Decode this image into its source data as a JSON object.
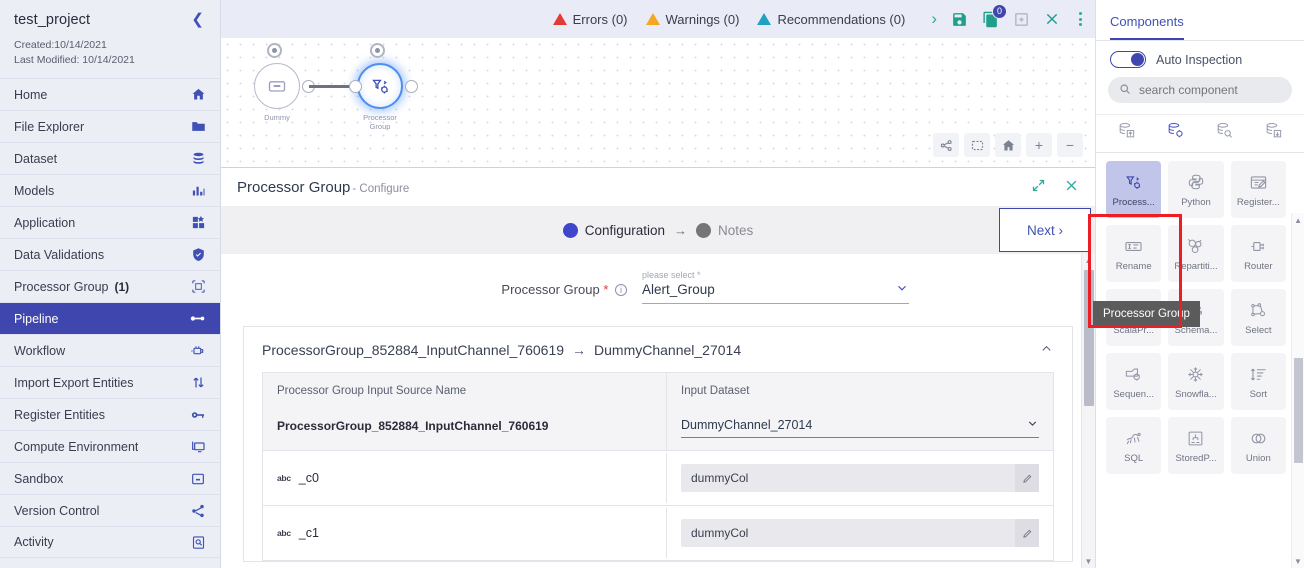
{
  "sidebar": {
    "project_title": "test_project",
    "collapse_icon": "chevron-left-icon",
    "created": "Created:10/14/2021",
    "last_modified": "Last Modified: 10/14/2021",
    "items": [
      {
        "label": "Home",
        "icon": "home-icon",
        "count": "",
        "active": false
      },
      {
        "label": "File Explorer",
        "icon": "folder-icon",
        "count": "",
        "active": false
      },
      {
        "label": "Dataset",
        "icon": "database-icon",
        "count": "",
        "active": false
      },
      {
        "label": "Models",
        "icon": "bar-chart-icon",
        "count": "",
        "active": false
      },
      {
        "label": "Application",
        "icon": "apps-grid-icon",
        "count": "",
        "active": false
      },
      {
        "label": "Data Validations",
        "icon": "shield-check-icon",
        "count": "",
        "active": false
      },
      {
        "label": "Processor Group",
        "icon": "processor-group-icon",
        "count": "(1)",
        "active": false
      },
      {
        "label": "Pipeline",
        "icon": "pipeline-icon",
        "count": "",
        "active": true
      },
      {
        "label": "Workflow",
        "icon": "workflow-icon",
        "count": "",
        "active": false
      },
      {
        "label": "Import Export Entities",
        "icon": "import-export-icon",
        "count": "",
        "active": false
      },
      {
        "label": "Register Entities",
        "icon": "key-icon",
        "count": "",
        "active": false
      },
      {
        "label": "Compute Environment",
        "icon": "monitor-icon",
        "count": "",
        "active": false
      },
      {
        "label": "Sandbox",
        "icon": "sandbox-icon",
        "count": "",
        "active": false
      },
      {
        "label": "Version Control",
        "icon": "share-icon",
        "count": "",
        "active": false
      },
      {
        "label": "Activity",
        "icon": "activity-search-icon",
        "count": "",
        "active": false
      }
    ]
  },
  "topbar": {
    "errors": "Errors (0)",
    "warnings": "Warnings (0)",
    "recommendations": "Recommendations (0)",
    "expand_icon": "chevron-right-icon",
    "save_icon": "save-icon",
    "copy_icon": "copy-icon",
    "copy_badge": "0",
    "add_panel_icon": "add-panel-icon",
    "close_icon": "close-icon",
    "more_icon": "kebab-menu-icon"
  },
  "canvas": {
    "nodes": [
      {
        "label": "Dummy",
        "icon": "dataset-node-icon",
        "selected": false
      },
      {
        "label": "Processor\nGroup",
        "label_line1": "Processor",
        "label_line2": "Group",
        "icon": "processor-group-node-icon",
        "selected": true
      }
    ],
    "tools": [
      {
        "name": "layout-icon",
        "glyph": ""
      },
      {
        "name": "select-box-icon",
        "glyph": ""
      },
      {
        "name": "home-icon",
        "glyph": ""
      },
      {
        "name": "zoom-in-icon",
        "glyph": "+"
      },
      {
        "name": "zoom-out-icon",
        "glyph": "−"
      }
    ]
  },
  "configure": {
    "title": "Processor Group",
    "subtitle": "- Configure",
    "expand_icon": "expand-icon",
    "close_icon": "close-icon",
    "steps": [
      {
        "label": "Configuration",
        "state": "active"
      },
      {
        "label": "Notes",
        "state": "inactive"
      }
    ],
    "step_separator": "→",
    "next_label": "Next ›",
    "processor_group_field": {
      "label": "Processor Group",
      "required_mark": "*",
      "info_icon": "info-icon",
      "hint": "please select *",
      "value": "Alert_Group",
      "caret_icon": "chevron-down-icon"
    },
    "mapping": {
      "source_channel": "ProcessorGroup_852884_InputChannel_760619",
      "arrow": "→",
      "target_channel": "DummyChannel_27014",
      "collapse_icon": "chevron-up-icon",
      "col1_header": "Processor Group Input Source Name",
      "col2_header": "Input Dataset",
      "source_value": "ProcessorGroup_852884_InputChannel_760619",
      "dataset_value": "DummyChannel_27014",
      "dataset_caret": "chevron-down-icon",
      "columns": [
        {
          "type_badge": "abc",
          "name": "_c0",
          "value": "dummyCol",
          "edit_icon": "pencil-icon"
        },
        {
          "type_badge": "abc",
          "name": "_c1",
          "value": "dummyCol",
          "edit_icon": "pencil-icon"
        }
      ]
    }
  },
  "right_panel": {
    "tab": "Components",
    "auto_inspection_label": "Auto Inspection",
    "auto_inspection_on": true,
    "search_placeholder": "search component",
    "search_value": "",
    "search_icon": "search-icon",
    "category_icons": [
      {
        "name": "dataset-source-icon",
        "active": false
      },
      {
        "name": "dataset-transform-icon",
        "active": true
      },
      {
        "name": "dataset-inspect-icon",
        "active": false
      },
      {
        "name": "dataset-sink-icon",
        "active": false
      }
    ],
    "components": [
      {
        "label": "Process...",
        "icon": "processor-group-icon",
        "selected": true
      },
      {
        "label": "Python",
        "icon": "python-icon",
        "selected": false
      },
      {
        "label": "Register...",
        "icon": "register-icon",
        "selected": false
      },
      {
        "label": "Rename",
        "icon": "rename-icon",
        "selected": false
      },
      {
        "label": "Repartiti...",
        "icon": "repartition-icon",
        "selected": false
      },
      {
        "label": "Router",
        "icon": "router-icon",
        "selected": false
      },
      {
        "label": "ScalaPr...",
        "icon": "scala-icon",
        "selected": false
      },
      {
        "label": "Schema...",
        "icon": "schema-icon",
        "selected": false
      },
      {
        "label": "Select",
        "icon": "select-icon",
        "selected": false
      },
      {
        "label": "Sequen...",
        "icon": "sequence-icon",
        "selected": false
      },
      {
        "label": "Snowfla...",
        "icon": "snowflake-icon",
        "selected": false
      },
      {
        "label": "Sort",
        "icon": "sort-icon",
        "selected": false
      },
      {
        "label": "SQL",
        "icon": "sql-icon",
        "selected": false
      },
      {
        "label": "StoredP...",
        "icon": "stored-procedure-icon",
        "selected": false
      },
      {
        "label": "Union",
        "icon": "union-icon",
        "selected": false
      }
    ],
    "tooltip": "Processor Group",
    "scroll_up_icon": "triangle-up-icon",
    "scroll_down_icon": "triangle-down-icon"
  },
  "colors": {
    "accent": "#3f46ad",
    "error": "#e23b34",
    "warning": "#f5a623",
    "recommendation": "#22a0bf",
    "teal": "#20a08a",
    "highlight": "#ee1c25"
  }
}
